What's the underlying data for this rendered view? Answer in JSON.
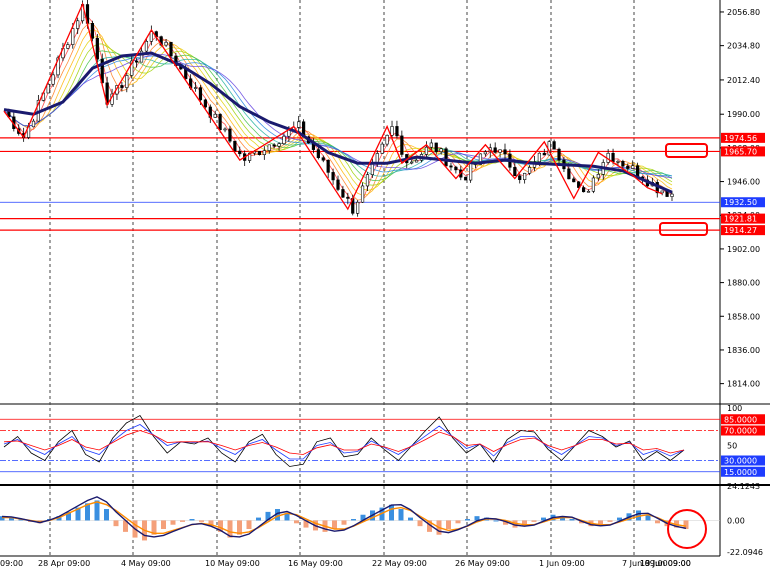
{
  "chart_data": [
    {
      "type": "candlestick",
      "panel": "price",
      "y_ticks": [
        "2056.80",
        "2034.80",
        "2012.40",
        "1990.00",
        "1968.00",
        "1946.00",
        "1924.00",
        "1902.00",
        "1880.00",
        "1858.00",
        "1836.00",
        "1814.00"
      ],
      "ylim": [
        1802,
        2062
      ],
      "grid": true,
      "horizontal_levels": [
        {
          "label": "1974.56",
          "value": 1974.56,
          "color": "#ff0000"
        },
        {
          "label": "1965.70",
          "value": 1965.7,
          "color": "#ff0000"
        },
        {
          "label": "1932.50",
          "value": 1932.5,
          "color": "#1e3cff"
        },
        {
          "label": "1921.81",
          "value": 1921.81,
          "color": "#ff0000"
        },
        {
          "label": "1914.27",
          "value": 1914.27,
          "color": "#ff0000"
        }
      ],
      "zigzag": [
        [
          0,
          1992
        ],
        [
          4,
          1975
        ],
        [
          16,
          2062
        ],
        [
          21,
          1996
        ],
        [
          30,
          2045
        ],
        [
          48,
          1960
        ],
        [
          59,
          1982
        ],
        [
          70,
          1928
        ],
        [
          78,
          1982
        ],
        [
          81,
          1958
        ],
        [
          86,
          1970
        ],
        [
          92,
          1948
        ],
        [
          98,
          1970
        ],
        [
          104,
          1948
        ],
        [
          110,
          1972
        ],
        [
          116,
          1935
        ],
        [
          121,
          1965
        ],
        [
          128,
          1950
        ],
        [
          131,
          1942
        ],
        [
          134,
          1938
        ]
      ],
      "ma_slow": [
        [
          0,
          1993
        ],
        [
          6,
          1990
        ],
        [
          12,
          1998
        ],
        [
          18,
          2020
        ],
        [
          24,
          2028
        ],
        [
          30,
          2030
        ],
        [
          36,
          2022
        ],
        [
          42,
          2010
        ],
        [
          48,
          1995
        ],
        [
          54,
          1985
        ],
        [
          60,
          1978
        ],
        [
          66,
          1965
        ],
        [
          72,
          1958
        ],
        [
          78,
          1958
        ],
        [
          84,
          1962
        ],
        [
          90,
          1960
        ],
        [
          96,
          1958
        ],
        [
          102,
          1960
        ],
        [
          108,
          1958
        ],
        [
          114,
          1957
        ],
        [
          120,
          1956
        ],
        [
          126,
          1953
        ],
        [
          131,
          1946
        ],
        [
          136,
          1939
        ]
      ]
    },
    {
      "type": "line",
      "panel": "oscillator",
      "y_ticks": [
        "100",
        "85.0000",
        "70.0000",
        "50",
        "30.0000",
        "15.0000"
      ],
      "ylim": [
        0,
        100
      ],
      "levels": [
        {
          "label": "85.0000",
          "value": 85,
          "color": "#ff0000"
        },
        {
          "label": "70.0000",
          "value": 70,
          "color": "#ff0000"
        },
        {
          "label": "30.0000",
          "value": 30,
          "color": "#1e3cff"
        },
        {
          "label": "15.0000",
          "value": 15,
          "color": "#1e3cff"
        }
      ],
      "series": [
        {
          "color": "#000000",
          "values": [
            48,
            62,
            40,
            30,
            55,
            70,
            38,
            28,
            60,
            80,
            90,
            62,
            40,
            55,
            52,
            60,
            40,
            28,
            55,
            65,
            38,
            22,
            25,
            55,
            60,
            35,
            38,
            60,
            44,
            30,
            50,
            70,
            88,
            60,
            40,
            52,
            28,
            58,
            70,
            68,
            45,
            30,
            50,
            70,
            62,
            48,
            56,
            30,
            42,
            30,
            44
          ]
        },
        {
          "color": "#1e3cff",
          "values": [
            52,
            58,
            46,
            38,
            52,
            62,
            44,
            38,
            56,
            70,
            78,
            64,
            50,
            55,
            54,
            56,
            46,
            38,
            52,
            58,
            44,
            32,
            32,
            50,
            54,
            40,
            42,
            56,
            47,
            38,
            50,
            63,
            76,
            62,
            46,
            52,
            36,
            54,
            62,
            62,
            48,
            38,
            50,
            62,
            60,
            50,
            54,
            38,
            44,
            36,
            44
          ]
        },
        {
          "color": "#ff0000",
          "values": [
            55,
            56,
            50,
            44,
            50,
            58,
            48,
            44,
            54,
            64,
            70,
            64,
            54,
            55,
            55,
            55,
            50,
            44,
            50,
            54,
            48,
            40,
            38,
            47,
            51,
            44,
            44,
            52,
            48,
            42,
            49,
            58,
            68,
            62,
            50,
            52,
            42,
            51,
            58,
            60,
            50,
            44,
            50,
            58,
            58,
            52,
            53,
            44,
            46,
            40,
            44
          ]
        }
      ]
    },
    {
      "type": "bar",
      "panel": "macd",
      "y_ticks": [
        "24.1243",
        "0.00",
        "-22.0946"
      ],
      "ylim": [
        -22.0946,
        24.1243
      ],
      "histogram": [
        3,
        2,
        1,
        -1,
        -2,
        1,
        3,
        6,
        9,
        12,
        14,
        8,
        -4,
        -8,
        -12,
        -14,
        -10,
        -6,
        -3,
        -1,
        1,
        -1,
        -4,
        -8,
        -12,
        -10,
        -6,
        2,
        6,
        8,
        5,
        -2,
        -5,
        -7,
        -8,
        -6,
        -3,
        1,
        4,
        7,
        9,
        11,
        8,
        2,
        -4,
        -8,
        -10,
        -6,
        -2,
        1,
        3,
        2,
        0,
        -3,
        -5,
        -4,
        -1,
        2,
        4,
        3,
        1,
        -2,
        -4,
        -3,
        -1,
        2,
        5,
        7,
        4,
        -2,
        -4,
        -5,
        -6
      ],
      "signal": [
        2,
        2,
        1,
        0,
        -1,
        0,
        2,
        5,
        8,
        11,
        13,
        11,
        7,
        2,
        -3,
        -7,
        -9,
        -9,
        -7,
        -5,
        -3,
        -2,
        -3,
        -5,
        -8,
        -9,
        -8,
        -5,
        -1,
        3,
        5,
        4,
        1,
        -2,
        -4,
        -6,
        -6,
        -4,
        -1,
        2,
        5,
        8,
        9,
        7,
        3,
        -1,
        -5,
        -7,
        -6,
        -4,
        -1,
        1,
        1,
        0,
        -2,
        -3,
        -3,
        -1,
        1,
        2,
        2,
        0,
        -2,
        -3,
        -3,
        -1,
        1,
        3,
        4,
        2,
        -1,
        -3,
        -4
      ]
    }
  ],
  "x_labels": [
    "09:00",
    "28 Apr 09:00",
    "4 May 09:00",
    "10 May 09:00",
    "16 May 09:00",
    "22 May 09:00",
    "26 May 09:00",
    "1 Jun 09:00",
    "7 Jun 09:00",
    "13 Jun 09:00",
    "19 Jun 09:00"
  ]
}
